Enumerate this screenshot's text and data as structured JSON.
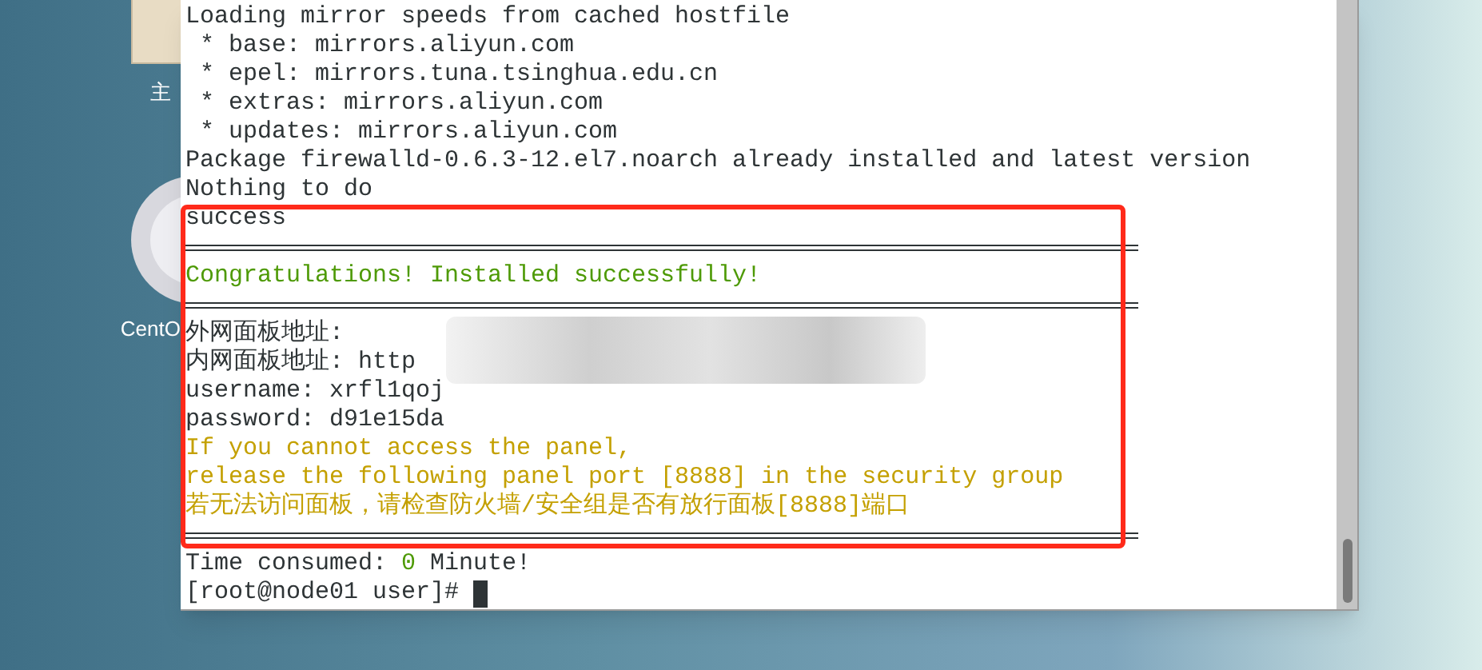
{
  "desktop_icons": [
    {
      "kind": "folder",
      "label": "主"
    },
    {
      "kind": "disc",
      "label": "CentO"
    }
  ],
  "terminal": {
    "lines": [
      {
        "kind": "text",
        "parts": [
          {
            "kind": "normal",
            "text": "Loading mirror speeds from cached hostfile"
          }
        ]
      },
      {
        "kind": "text",
        "parts": [
          {
            "kind": "normal",
            "text": " * base: mirrors.aliyun.com"
          }
        ]
      },
      {
        "kind": "text",
        "parts": [
          {
            "kind": "normal",
            "text": " * epel: mirrors.tuna.tsinghua.edu.cn"
          }
        ]
      },
      {
        "kind": "text",
        "parts": [
          {
            "kind": "normal",
            "text": " * extras: mirrors.aliyun.com"
          }
        ]
      },
      {
        "kind": "text",
        "parts": [
          {
            "kind": "normal",
            "text": " * updates: mirrors.aliyun.com"
          }
        ]
      },
      {
        "kind": "text",
        "parts": [
          {
            "kind": "normal",
            "text": "Package firewalld-0.6.3-12.el7.noarch already installed and latest version"
          }
        ]
      },
      {
        "kind": "text",
        "parts": [
          {
            "kind": "normal",
            "text": "Nothing to do"
          }
        ]
      },
      {
        "kind": "text",
        "parts": [
          {
            "kind": "normal",
            "text": "success"
          }
        ]
      },
      {
        "kind": "rule"
      },
      {
        "kind": "text",
        "parts": [
          {
            "kind": "success",
            "text": "Congratulations! Installed successfully!"
          }
        ]
      },
      {
        "kind": "rule"
      },
      {
        "kind": "text",
        "parts": [
          {
            "kind": "normal",
            "text": "外网面板地址:"
          }
        ]
      },
      {
        "kind": "text",
        "parts": [
          {
            "kind": "normal",
            "text": "内网面板地址: http"
          }
        ]
      },
      {
        "kind": "text",
        "parts": [
          {
            "kind": "normal",
            "text": "username: xrfl1qoj"
          }
        ]
      },
      {
        "kind": "text",
        "parts": [
          {
            "kind": "normal",
            "text": "password: d91e15da"
          }
        ]
      },
      {
        "kind": "text",
        "parts": [
          {
            "kind": "warning",
            "text": "If you cannot access the panel,"
          }
        ]
      },
      {
        "kind": "text",
        "parts": [
          {
            "kind": "warning",
            "text": "release the following panel port [8888] in the security group"
          }
        ]
      },
      {
        "kind": "text",
        "parts": [
          {
            "kind": "warning",
            "text": "若无法访问面板，请检查防火墙/安全组是否有放行面板[8888]端口"
          }
        ]
      },
      {
        "kind": "rule"
      },
      {
        "kind": "text",
        "parts": [
          {
            "kind": "normal",
            "text": "Time consumed: "
          },
          {
            "kind": "success",
            "text": "0"
          },
          {
            "kind": "normal",
            "text": " Minute!"
          }
        ]
      }
    ],
    "prompt": "[root@node01 user]# "
  }
}
